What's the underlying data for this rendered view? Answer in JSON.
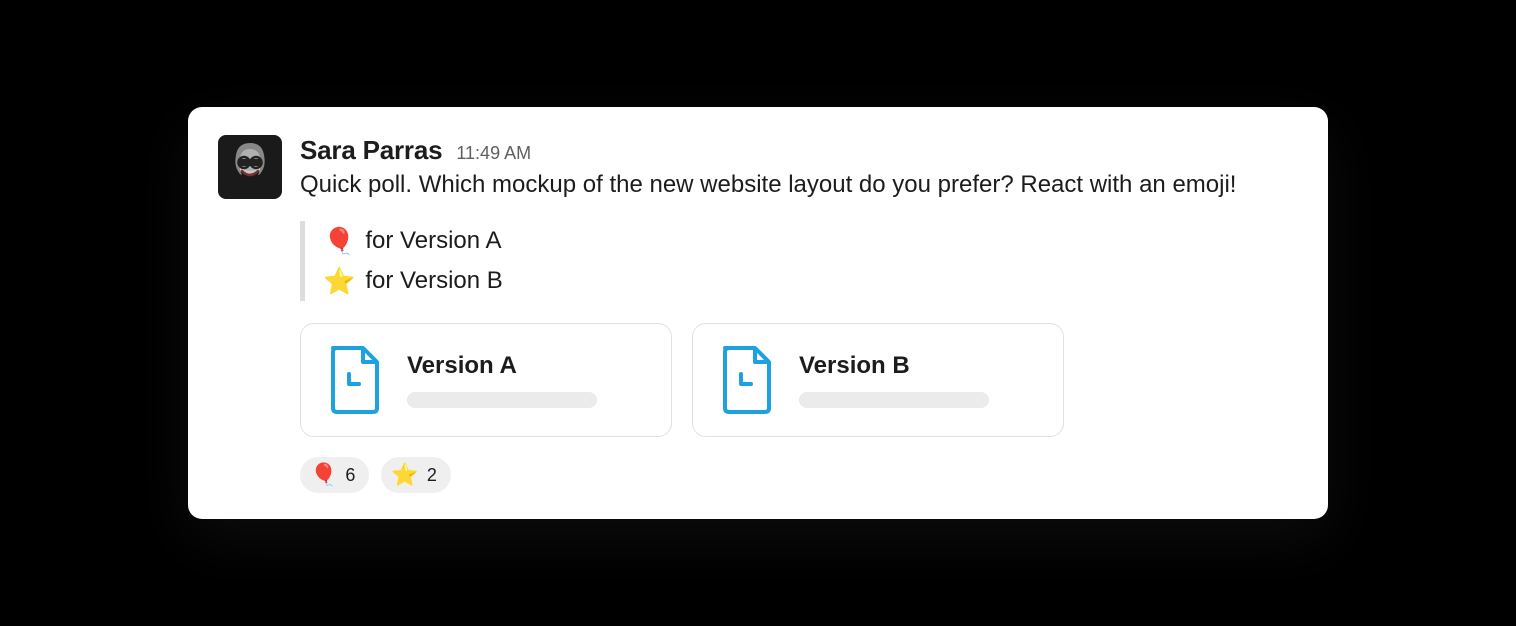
{
  "message": {
    "author": "Sara Parras",
    "timestamp": "11:49 AM",
    "text": "Quick poll. Which mockup of the new website layout do you prefer? React with an emoji!",
    "options": [
      {
        "emoji": "🎈",
        "label": "for Version A"
      },
      {
        "emoji": "⭐",
        "label": "for Version B"
      }
    ],
    "attachments": [
      {
        "title": "Version A"
      },
      {
        "title": "Version B"
      }
    ],
    "reactions": [
      {
        "emoji": "🎈",
        "count": "6"
      },
      {
        "emoji": "⭐",
        "count": "2"
      }
    ]
  }
}
